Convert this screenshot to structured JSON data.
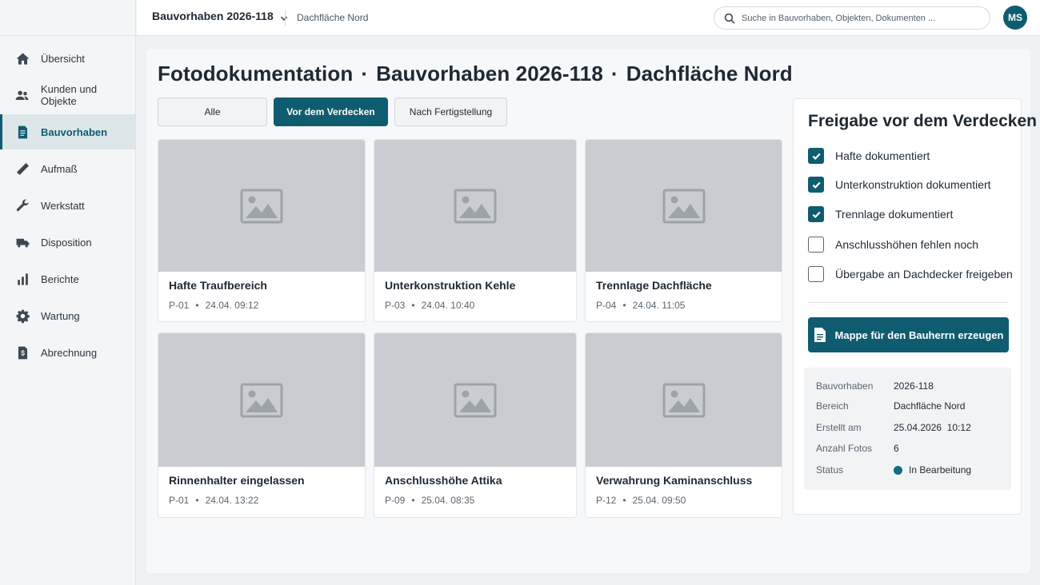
{
  "sidebar": {
    "items": [
      {
        "label": "Übersicht",
        "icon": "home-icon"
      },
      {
        "label": "Kunden und Objekte",
        "icon": "users-icon"
      },
      {
        "label": "Bauvorhaben",
        "icon": "document-icon",
        "active": true
      },
      {
        "label": "Aufmaß",
        "icon": "ruler-icon"
      },
      {
        "label": "Werkstatt",
        "icon": "wrench-icon"
      },
      {
        "label": "Disposition",
        "icon": "truck-icon"
      },
      {
        "label": "Berichte",
        "icon": "bar-chart-icon"
      },
      {
        "label": "Wartung",
        "icon": "gear-icon"
      },
      {
        "label": "Abrechnung",
        "icon": "invoice-icon"
      }
    ]
  },
  "topbar": {
    "project": "Bauvorhaben 2026-118",
    "crumb": "Dachfläche Nord",
    "search_placeholder": "Suche in Bauvorhaben, Objekten, Dokumenten ...",
    "avatar_initials": "MS"
  },
  "page": {
    "title_part1": "Fotodokumentation",
    "title_part2": "Bauvorhaben 2026-118",
    "title_part3": "Dachfläche Nord",
    "separator": "·"
  },
  "filters": [
    {
      "label": "Alle",
      "active": false
    },
    {
      "label": "Vor dem Verdecken",
      "active": true
    },
    {
      "label": "Nach Fertigstellung",
      "active": false
    }
  ],
  "photos": [
    {
      "title": "Hafte Traufbereich",
      "position": "P-01",
      "date": "24.04.",
      "time": "09:12"
    },
    {
      "title": "Unterkonstruktion Kehle",
      "position": "P-03",
      "date": "24.04.",
      "time": "10:40"
    },
    {
      "title": "Trennlage Dachfläche",
      "position": "P-04",
      "date": "24.04.",
      "time": "11:05"
    },
    {
      "title": "Rinnenhalter eingelassen",
      "position": "P-01",
      "date": "24.04.",
      "time": "13:22"
    },
    {
      "title": "Anschlusshöhe Attika",
      "position": "P-09",
      "date": "25.04.",
      "time": "08:35"
    },
    {
      "title": "Verwahrung Kaminanschluss",
      "position": "P-12",
      "date": "25.04.",
      "time": "09:50"
    }
  ],
  "panel": {
    "title": "Freigabe vor dem Verdecken",
    "checklist": [
      {
        "label": "Hafte dokumentiert",
        "checked": true
      },
      {
        "label": "Unterkonstruktion dokumentiert",
        "checked": true
      },
      {
        "label": "Trennlage dokumentiert",
        "checked": true
      },
      {
        "label": "Anschlusshöhen fehlen noch",
        "checked": false
      },
      {
        "label": "Übergabe an Dachdecker freigeben",
        "checked": false
      }
    ],
    "button_label": "Mappe für den Bauherrn erzeugen",
    "info": [
      {
        "key": "Bauvorhaben",
        "value": "2026-118"
      },
      {
        "key": "Bereich",
        "value": "Dachfläche Nord"
      },
      {
        "key": "Erstellt am",
        "value": "25.04.2026  10:12"
      },
      {
        "key": "Anzahl Fotos",
        "value": "6"
      },
      {
        "key": "Status",
        "value": "In Bearbeitung"
      }
    ]
  },
  "colors": {
    "accent": "#0f5c70",
    "placeholder": "#c9ccd0",
    "status": "#0f6e82"
  }
}
